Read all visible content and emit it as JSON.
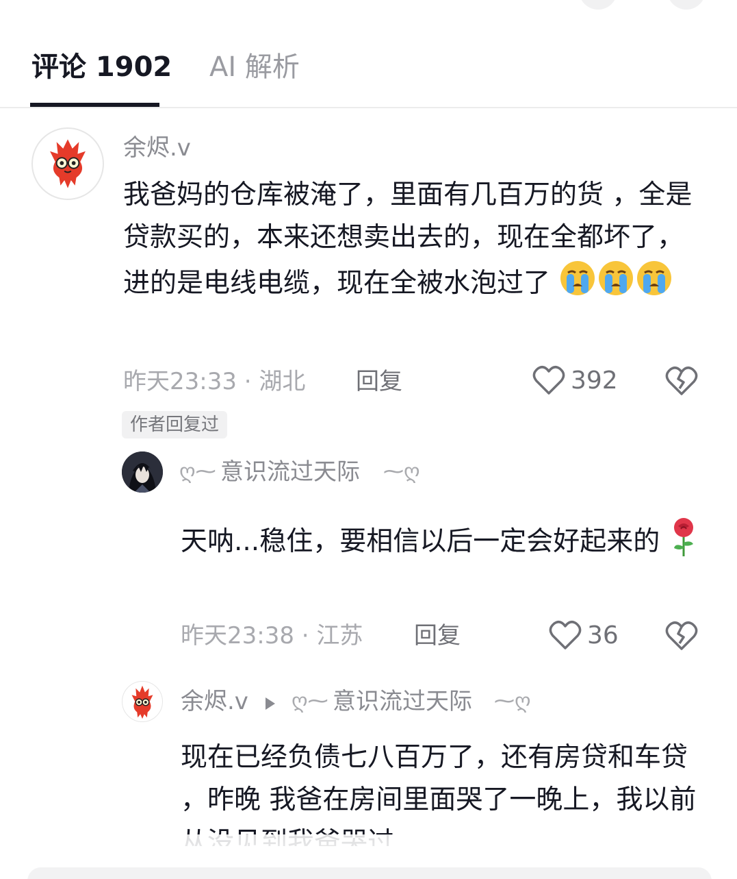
{
  "tabs": [
    {
      "label": "评论 1902"
    },
    {
      "label": "AI 解析"
    }
  ],
  "comments": [
    {
      "username": "余烬.v",
      "text": "我爸妈的仓库被淹了，里面有几百万的货 ，全是贷款买的，本来还想卖出去的，现在全都坏了，进的是电线电缆，现在全被水泡过了",
      "emoji": [
        "loudly-crying-face",
        "loudly-crying-face",
        "loudly-crying-face"
      ],
      "time": "昨天23:33",
      "location": "湖北",
      "reply_label": "回复",
      "likes": "392",
      "badge": "作者回复过"
    }
  ],
  "replies": [
    {
      "username": "意识流过天际",
      "text": "天呐...稳住，要相信以后一定会好起来的",
      "emoji": [
        "rose"
      ],
      "time": "昨天23:38",
      "location": "江苏",
      "reply_label": "回复",
      "likes": "36"
    },
    {
      "username": "余烬.v",
      "reply_to": "意识流过天际",
      "text": "现在已经负债七八百万了，还有房贷和车贷 ，昨晚 我爸在房间里面哭了一晚上，我以前从没见到我爸哭过"
    }
  ],
  "separator": "·",
  "colors": {
    "primary_text": "#161823",
    "secondary_text": "#8a8b91",
    "meta_text": "#a8a9ae",
    "badge_bg": "#f1f1f2",
    "tab_underline": "#161823"
  },
  "icons": {
    "like": "heart-outline-icon",
    "dislike": "broken-heart-icon"
  }
}
